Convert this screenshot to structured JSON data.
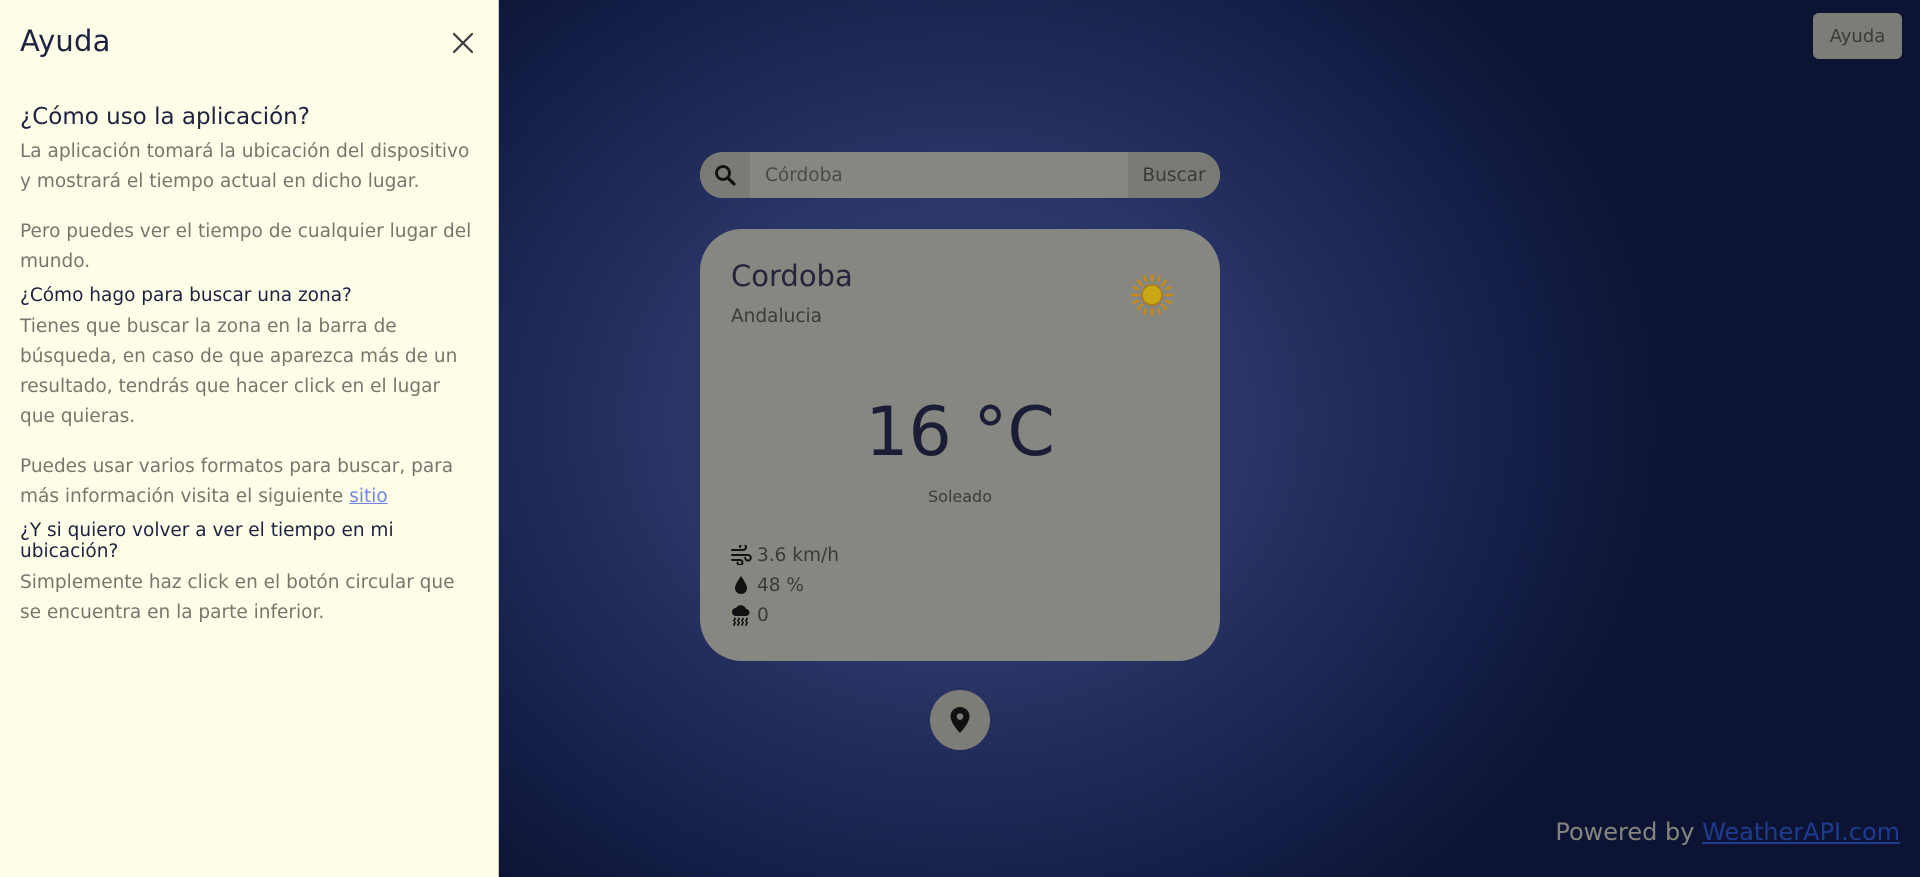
{
  "help_panel": {
    "title": "Ayuda",
    "sections": [
      {
        "heading": "¿Cómo uso la aplicación?",
        "paragraphs": [
          "La aplicación tomará la ubicación del dispositivo y mostrará el tiempo actual en dicho lugar.",
          "Pero puedes ver el tiempo de cualquier lugar del mundo."
        ]
      },
      {
        "heading": "¿Cómo hago para buscar una zona?",
        "paragraphs": [
          "Tienes que buscar la zona en la barra de búsqueda, en caso de que aparezca más de un resultado, tendrás que hacer click en el lugar que quieras.",
          "Puedes usar varios formatos para buscar, para más información visita el siguiente "
        ],
        "link_text": "sitio"
      },
      {
        "heading": "¿Y si quiero volver a ver el tiempo en mi ubicación?",
        "paragraphs": [
          "Simplemente haz click en el botón circular que se encuentra en la parte inferior."
        ]
      }
    ]
  },
  "header": {
    "help_button_label": "Ayuda"
  },
  "search": {
    "placeholder": "Córdoba",
    "button_label": "Buscar"
  },
  "weather": {
    "city": "Cordoba",
    "region": "Andalucia",
    "temperature": "16 °C",
    "condition": "Soleado",
    "wind": "3.6 km/h",
    "humidity": "48 %",
    "precipitation": "0",
    "icon": "sun-icon"
  },
  "footer": {
    "powered_by": "Powered by ",
    "provider_link": "WeatherAPI.com"
  },
  "colors": {
    "panel_bg": "#fefee8",
    "background": "#2a3566",
    "card_bg": "#878782",
    "sun": "#c9a815",
    "link": "#6f86e6"
  }
}
